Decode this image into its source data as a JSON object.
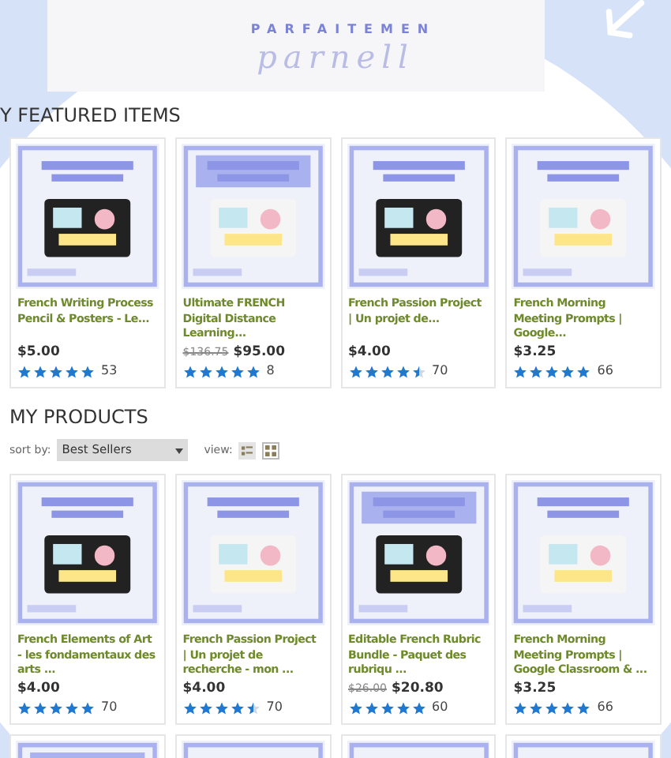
{
  "banner": {
    "title": "PARFAITEMEN",
    "script": "parnell"
  },
  "featured": {
    "heading": "Y FEATURED ITEMS",
    "items": [
      {
        "title": "French Writing Process Pencil & Posters - Le...",
        "price": "$5.00",
        "stars": 5,
        "count": "53"
      },
      {
        "title": "Ultimate FRENCH Digital Distance Learning...",
        "old_price": "$136.75",
        "price": "$95.00",
        "stars": 5,
        "count": "8"
      },
      {
        "title": "French Passion Project | Un projet de...",
        "price": "$4.00",
        "stars": 4.5,
        "count": "70"
      },
      {
        "title": "French Morning Meeting Prompts | Google...",
        "price": "$3.25",
        "stars": 5,
        "count": "66"
      }
    ]
  },
  "products": {
    "heading": "MY PRODUCTS",
    "sort_label": "sort by:",
    "sort_value": "Best Sellers",
    "view_label": "view:",
    "views": [
      {
        "kind": "list",
        "selected": false
      },
      {
        "kind": "grid",
        "selected": true
      }
    ],
    "items": [
      {
        "title": "French Elements of Art - les fondamentaux des arts ...",
        "price": "$4.00",
        "stars": 5,
        "count": "70"
      },
      {
        "title": "French Passion Project | Un projet de recherche - mon ...",
        "price": "$4.00",
        "stars": 4.5,
        "count": "70"
      },
      {
        "title": "Editable French Rubric Bundle - Paquet des rubriqu ...",
        "old_price": "$26.00",
        "price": "$20.80",
        "stars": 5,
        "count": "60"
      },
      {
        "title": "French Morning Meeting Prompts | Google Classroom & ...",
        "price": "$3.25",
        "stars": 5,
        "count": "66"
      }
    ]
  }
}
